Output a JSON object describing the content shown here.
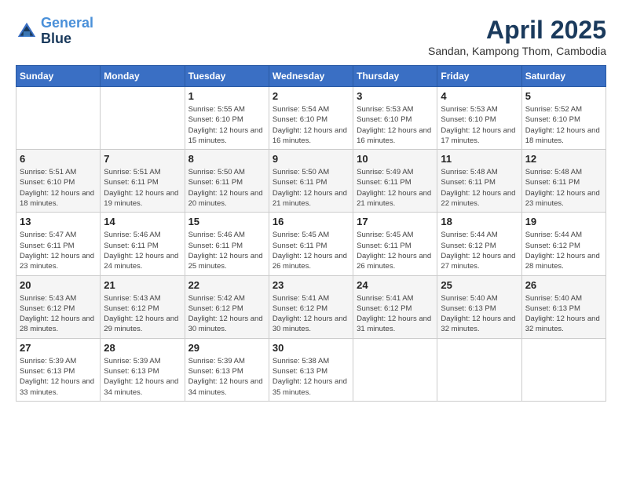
{
  "header": {
    "logo_line1": "General",
    "logo_line2": "Blue",
    "month_title": "April 2025",
    "subtitle": "Sandan, Kampong Thom, Cambodia"
  },
  "days_of_week": [
    "Sunday",
    "Monday",
    "Tuesday",
    "Wednesday",
    "Thursday",
    "Friday",
    "Saturday"
  ],
  "weeks": [
    [
      {
        "day": "",
        "info": ""
      },
      {
        "day": "",
        "info": ""
      },
      {
        "day": "1",
        "info": "Sunrise: 5:55 AM\nSunset: 6:10 PM\nDaylight: 12 hours and 15 minutes."
      },
      {
        "day": "2",
        "info": "Sunrise: 5:54 AM\nSunset: 6:10 PM\nDaylight: 12 hours and 16 minutes."
      },
      {
        "day": "3",
        "info": "Sunrise: 5:53 AM\nSunset: 6:10 PM\nDaylight: 12 hours and 16 minutes."
      },
      {
        "day": "4",
        "info": "Sunrise: 5:53 AM\nSunset: 6:10 PM\nDaylight: 12 hours and 17 minutes."
      },
      {
        "day": "5",
        "info": "Sunrise: 5:52 AM\nSunset: 6:10 PM\nDaylight: 12 hours and 18 minutes."
      }
    ],
    [
      {
        "day": "6",
        "info": "Sunrise: 5:51 AM\nSunset: 6:10 PM\nDaylight: 12 hours and 18 minutes."
      },
      {
        "day": "7",
        "info": "Sunrise: 5:51 AM\nSunset: 6:11 PM\nDaylight: 12 hours and 19 minutes."
      },
      {
        "day": "8",
        "info": "Sunrise: 5:50 AM\nSunset: 6:11 PM\nDaylight: 12 hours and 20 minutes."
      },
      {
        "day": "9",
        "info": "Sunrise: 5:50 AM\nSunset: 6:11 PM\nDaylight: 12 hours and 21 minutes."
      },
      {
        "day": "10",
        "info": "Sunrise: 5:49 AM\nSunset: 6:11 PM\nDaylight: 12 hours and 21 minutes."
      },
      {
        "day": "11",
        "info": "Sunrise: 5:48 AM\nSunset: 6:11 PM\nDaylight: 12 hours and 22 minutes."
      },
      {
        "day": "12",
        "info": "Sunrise: 5:48 AM\nSunset: 6:11 PM\nDaylight: 12 hours and 23 minutes."
      }
    ],
    [
      {
        "day": "13",
        "info": "Sunrise: 5:47 AM\nSunset: 6:11 PM\nDaylight: 12 hours and 23 minutes."
      },
      {
        "day": "14",
        "info": "Sunrise: 5:46 AM\nSunset: 6:11 PM\nDaylight: 12 hours and 24 minutes."
      },
      {
        "day": "15",
        "info": "Sunrise: 5:46 AM\nSunset: 6:11 PM\nDaylight: 12 hours and 25 minutes."
      },
      {
        "day": "16",
        "info": "Sunrise: 5:45 AM\nSunset: 6:11 PM\nDaylight: 12 hours and 26 minutes."
      },
      {
        "day": "17",
        "info": "Sunrise: 5:45 AM\nSunset: 6:11 PM\nDaylight: 12 hours and 26 minutes."
      },
      {
        "day": "18",
        "info": "Sunrise: 5:44 AM\nSunset: 6:12 PM\nDaylight: 12 hours and 27 minutes."
      },
      {
        "day": "19",
        "info": "Sunrise: 5:44 AM\nSunset: 6:12 PM\nDaylight: 12 hours and 28 minutes."
      }
    ],
    [
      {
        "day": "20",
        "info": "Sunrise: 5:43 AM\nSunset: 6:12 PM\nDaylight: 12 hours and 28 minutes."
      },
      {
        "day": "21",
        "info": "Sunrise: 5:43 AM\nSunset: 6:12 PM\nDaylight: 12 hours and 29 minutes."
      },
      {
        "day": "22",
        "info": "Sunrise: 5:42 AM\nSunset: 6:12 PM\nDaylight: 12 hours and 30 minutes."
      },
      {
        "day": "23",
        "info": "Sunrise: 5:41 AM\nSunset: 6:12 PM\nDaylight: 12 hours and 30 minutes."
      },
      {
        "day": "24",
        "info": "Sunrise: 5:41 AM\nSunset: 6:12 PM\nDaylight: 12 hours and 31 minutes."
      },
      {
        "day": "25",
        "info": "Sunrise: 5:40 AM\nSunset: 6:13 PM\nDaylight: 12 hours and 32 minutes."
      },
      {
        "day": "26",
        "info": "Sunrise: 5:40 AM\nSunset: 6:13 PM\nDaylight: 12 hours and 32 minutes."
      }
    ],
    [
      {
        "day": "27",
        "info": "Sunrise: 5:39 AM\nSunset: 6:13 PM\nDaylight: 12 hours and 33 minutes."
      },
      {
        "day": "28",
        "info": "Sunrise: 5:39 AM\nSunset: 6:13 PM\nDaylight: 12 hours and 34 minutes."
      },
      {
        "day": "29",
        "info": "Sunrise: 5:39 AM\nSunset: 6:13 PM\nDaylight: 12 hours and 34 minutes."
      },
      {
        "day": "30",
        "info": "Sunrise: 5:38 AM\nSunset: 6:13 PM\nDaylight: 12 hours and 35 minutes."
      },
      {
        "day": "",
        "info": ""
      },
      {
        "day": "",
        "info": ""
      },
      {
        "day": "",
        "info": ""
      }
    ]
  ]
}
